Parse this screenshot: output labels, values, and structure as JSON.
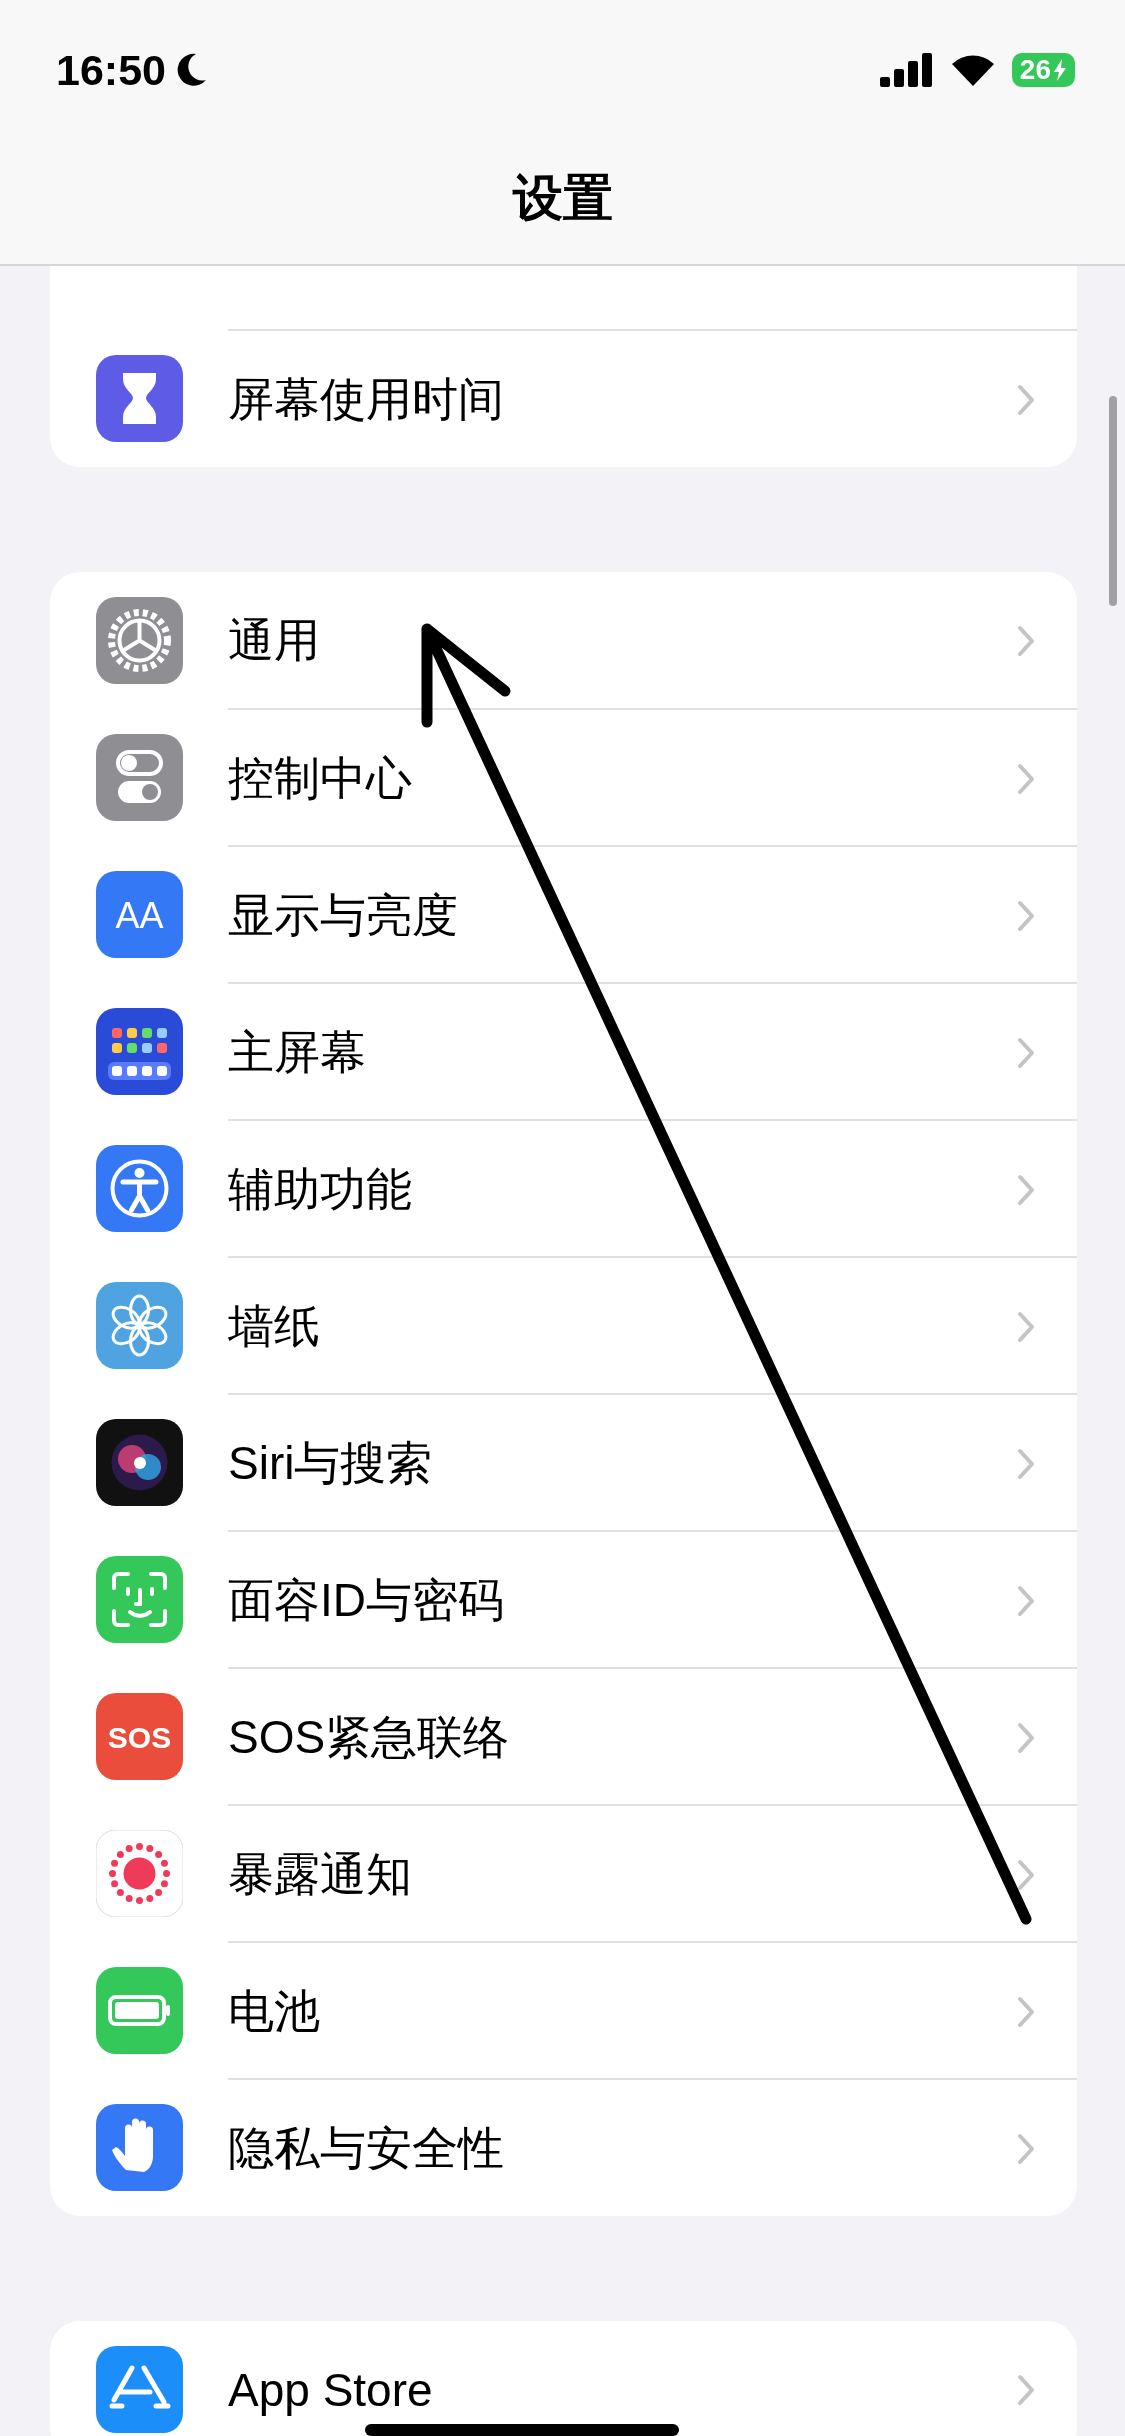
{
  "status_bar": {
    "time": "16:50",
    "battery": "26"
  },
  "title": "设置",
  "groups": [
    {
      "rows": [
        {
          "label": "屏幕使用时间",
          "kind": "screen_time"
        }
      ]
    },
    {
      "rows": [
        {
          "label": "通用",
          "kind": "general"
        },
        {
          "label": "控制中心",
          "kind": "control_center"
        },
        {
          "label": "显示与亮度",
          "kind": "display",
          "icon_text": "AA"
        },
        {
          "label": "主屏幕",
          "kind": "home_screen"
        },
        {
          "label": "辅助功能",
          "kind": "accessibility"
        },
        {
          "label": "墙纸",
          "kind": "wallpaper"
        },
        {
          "label": "Siri与搜索",
          "kind": "siri"
        },
        {
          "label": "面容ID与密码",
          "kind": "face_id"
        },
        {
          "label": "SOS紧急联络",
          "kind": "sos",
          "icon_text": "SOS"
        },
        {
          "label": "暴露通知",
          "kind": "exposure"
        },
        {
          "label": "电池",
          "kind": "battery"
        },
        {
          "label": "隐私与安全性",
          "kind": "privacy"
        }
      ]
    },
    {
      "rows": [
        {
          "label": "App Store",
          "kind": "app_store"
        }
      ]
    }
  ]
}
